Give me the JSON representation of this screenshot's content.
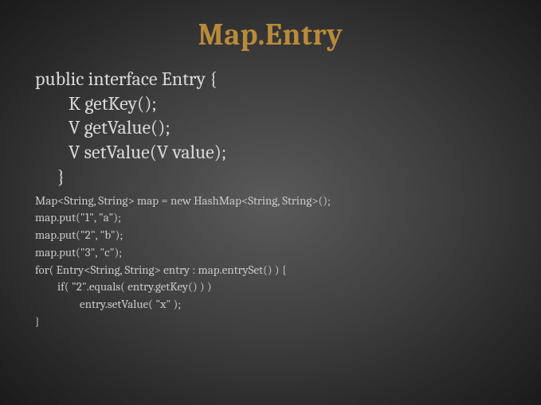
{
  "title": "Map.Entry",
  "interface": {
    "decl": "public interface Entry {",
    "m1": "K getKey();",
    "m2": "V getValue();",
    "m3": "V setValue(V value);",
    "close": "}"
  },
  "code": {
    "l1": "Map<String, String> map = new HashMap<String, String>();",
    "l2": "map.put(\"1\", \"a\");",
    "l3": "map.put(\"2\", \"b\");",
    "l4": "map.put(\"3\", \"c\");",
    "l5": "for( Entry<String, String> entry : map.entrySet() ) {",
    "l6": "if( \"2\".equals( entry.getKey() ) )",
    "l7": "entry.setValue( \"x\" );",
    "l8": "}"
  }
}
